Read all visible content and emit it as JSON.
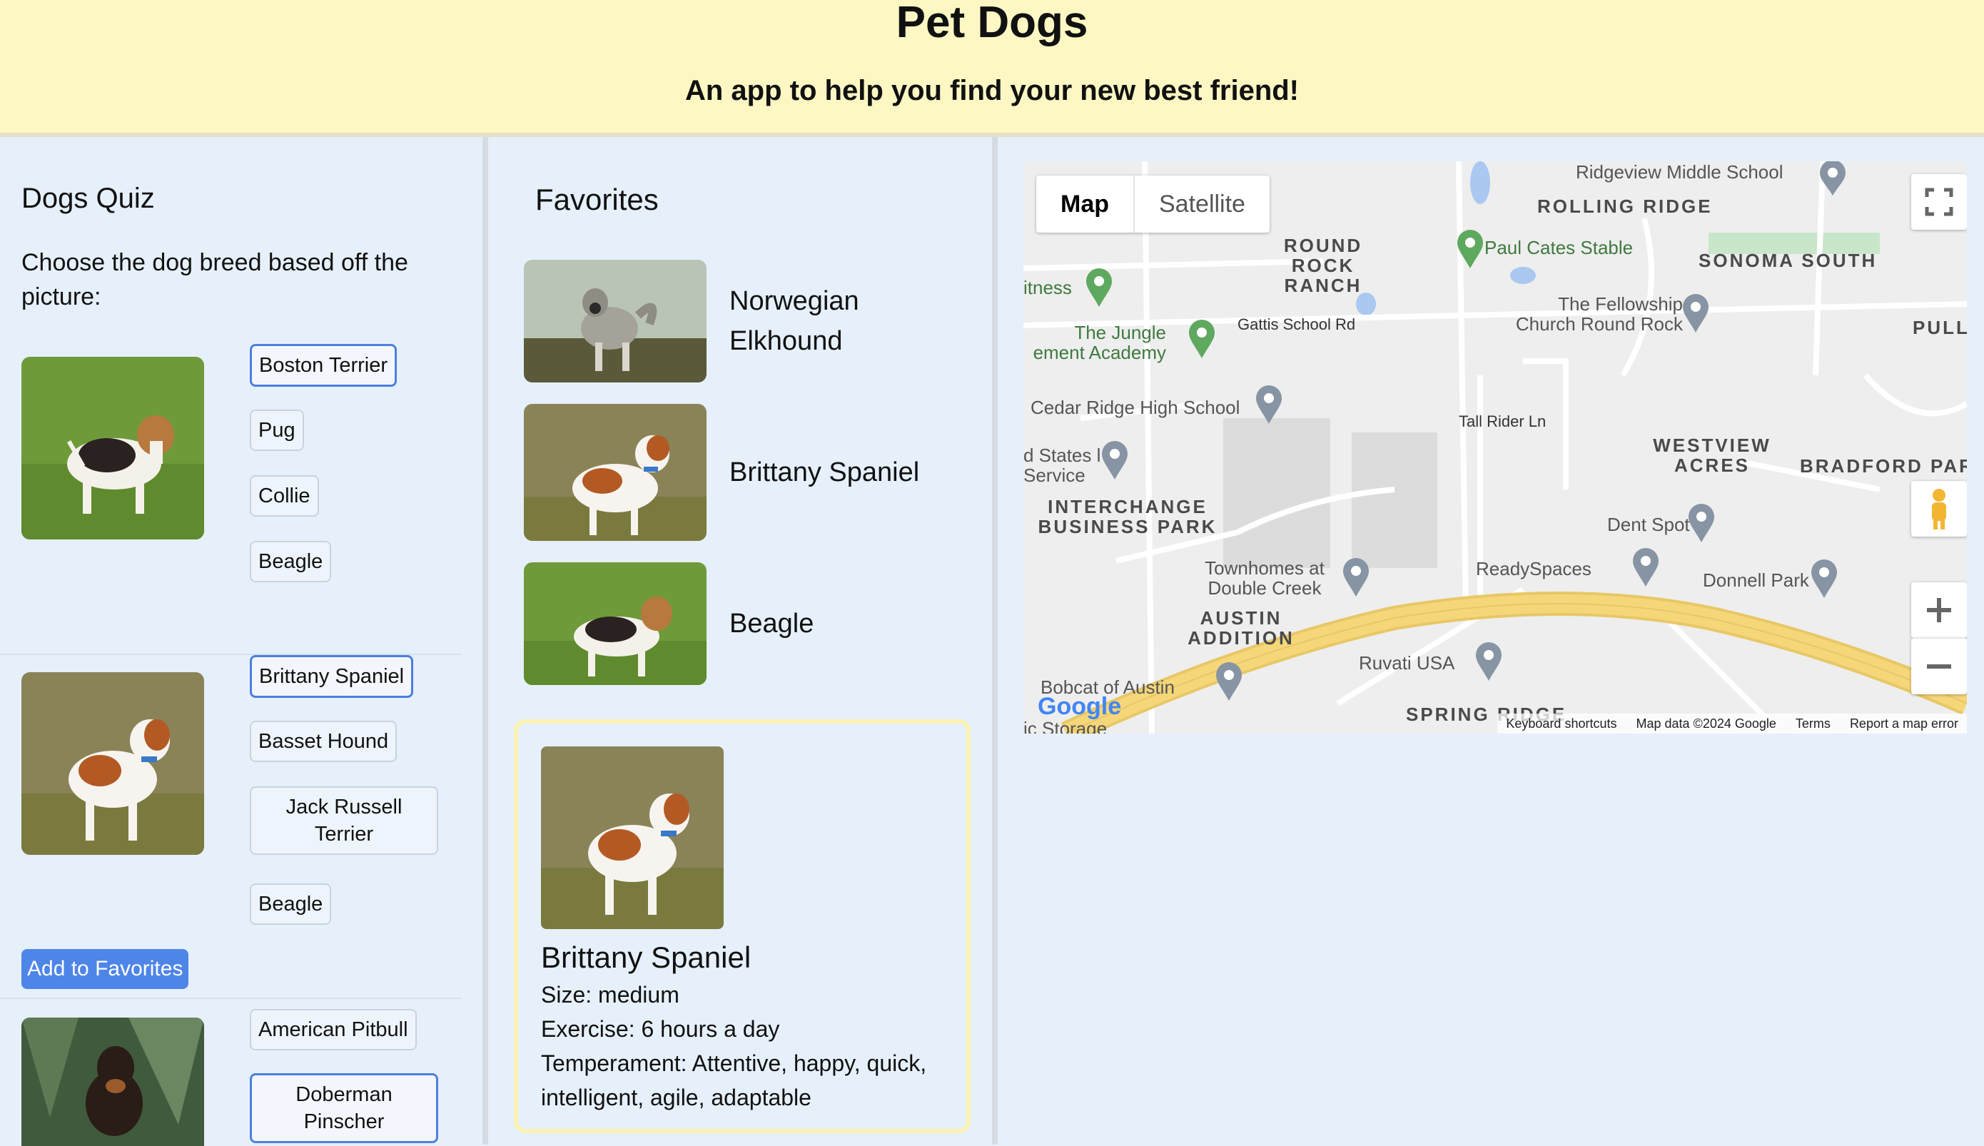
{
  "header": {
    "title": "Pet Dogs",
    "subtitle": "An app to help you find your new best friend!"
  },
  "quiz": {
    "title": "Dogs Quiz",
    "instructions": "Choose the dog breed based off the picture:",
    "add_label": "Add to Favorites",
    "questions": [
      {
        "image_icon": "beagle-photo",
        "options": [
          "Boston Terrier",
          "Pug",
          "Collie",
          "Beagle"
        ],
        "selected": "Boston Terrier"
      },
      {
        "image_icon": "brittany-spaniel-photo",
        "options": [
          "Brittany Spaniel",
          "Basset Hound",
          "Jack Russell Terrier",
          "Beagle"
        ],
        "selected": "Brittany Spaniel"
      },
      {
        "image_icon": "doberman-photo",
        "options": [
          "American Pitbull",
          "Doberman Pinscher"
        ],
        "selected": "Doberman Pinscher"
      }
    ]
  },
  "favorites": {
    "title": "Favorites",
    "items": [
      {
        "name": "Norwegian Elkhound",
        "image_icon": "elkhound-photo"
      },
      {
        "name": "Brittany Spaniel",
        "image_icon": "brittany-spaniel-photo"
      },
      {
        "name": "Beagle",
        "image_icon": "beagle-photo"
      }
    ],
    "detail": {
      "name": "Brittany Spaniel",
      "size": "Size: medium",
      "exercise": "Exercise: 6 hours a day",
      "temperament": "Temperament: Attentive, happy, quick, intelligent, agile, adaptable"
    }
  },
  "map": {
    "type_buttons": [
      "Map",
      "Satellite"
    ],
    "active_type": "Map",
    "areas": [
      "ROUND ROCK RANCH",
      "ROLLING RIDGE",
      "SONOMA SOUTH",
      "WESTVIEW ACRES",
      "INTERCHANGE BUSINESS PARK",
      "AUSTIN ADDITION",
      "BRADFORD PAR",
      "SPRING RIDGE",
      "PULL"
    ],
    "places": [
      "Ridgeview Middle School",
      "Paul Cates Stable",
      "The Fellowship Church Round Rock",
      "Gattis School Rd",
      "The Jungle ement Academy",
      "itness",
      "Cedar Ridge High School",
      "d States l Service",
      "Tall Rider Ln",
      "Dent Spot",
      "ReadySpaces",
      "Donnell Park",
      "Townhomes at Double Creek",
      "Ruvati USA",
      "Bobcat of Austin",
      "ic Storage"
    ],
    "footer": [
      "Keyboard shortcuts",
      "Map data ©2024 Google",
      "Terms",
      "Report a map error"
    ],
    "logo": "Google",
    "colors": {
      "highway": "#f5d77a",
      "park": "#c8e6c9",
      "water": "#aac8f0"
    }
  }
}
